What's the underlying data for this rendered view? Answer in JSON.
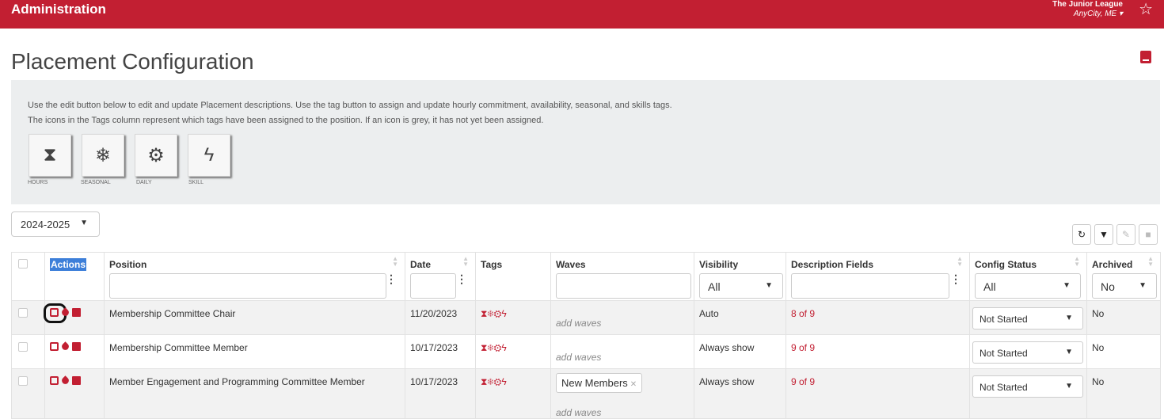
{
  "topbar": {
    "title": "Administration",
    "org_name": "The Junior League",
    "org_city": "AnyCity, ME ▾",
    "favorite_icon": "star-icon"
  },
  "page": {
    "title": "Placement Configuration",
    "help_icon": "book-icon"
  },
  "info": {
    "line1": "Use the edit button below to edit and update Placement descriptions. Use the tag button to assign and update hourly commitment, availability, seasonal, and skills tags.",
    "line2": "The icons in the Tags column represent which tags have been assigned to the position. If an icon is grey, it has not yet been assigned.",
    "tags": [
      {
        "label": "HOURS",
        "icon": "hourglass-icon",
        "glyph": "⧗"
      },
      {
        "label": "SEASONAL",
        "icon": "snowflake-icon",
        "glyph": "❄"
      },
      {
        "label": "DAILY",
        "icon": "sun-icon",
        "glyph": "⚙"
      },
      {
        "label": "SKILL",
        "icon": "bolt-icon",
        "glyph": "ϟ"
      }
    ]
  },
  "year_select": {
    "value": "2024-2025"
  },
  "toolbar": {
    "refresh_glyph": "↻",
    "filter_glyph": "▼",
    "edit_glyph": "✎",
    "delete_glyph": "■"
  },
  "table": {
    "headers": {
      "actions": "Actions",
      "position": "Position",
      "date": "Date",
      "tags": "Tags",
      "waves": "Waves",
      "visibility": "Visibility",
      "description_fields": "Description Fields",
      "config_status": "Config Status",
      "archived": "Archived"
    },
    "filters": {
      "visibility": "All",
      "config_status": "All",
      "archived": "No"
    },
    "tag_glyphs": "⧗❄⚙ϟ",
    "rows": [
      {
        "position": "Membership Committee Chair",
        "date": "11/20/2023",
        "wave": "",
        "add_waves": "add waves",
        "visibility": "Auto",
        "desc": "8 of 9",
        "status": "Not Started",
        "archived": "No"
      },
      {
        "position": "Membership Committee Member",
        "date": "10/17/2023",
        "wave": "",
        "add_waves": "add waves",
        "visibility": "Always show",
        "desc": "9 of 9",
        "status": "Not Started",
        "archived": "No"
      },
      {
        "position": "Member Engagement and Programming Committee Member",
        "date": "10/17/2023",
        "wave": "New Members",
        "add_waves": "add waves",
        "visibility": "Always show",
        "desc": "9 of 9",
        "status": "Not Started",
        "archived": "No"
      }
    ]
  },
  "colors": {
    "brand": "#c21f32",
    "highlight": "#3d7fd9"
  }
}
